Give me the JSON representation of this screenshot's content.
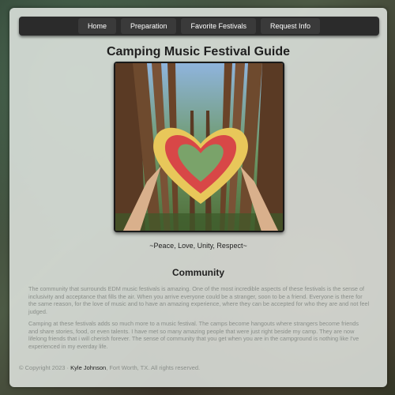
{
  "nav": {
    "items": [
      {
        "label": "Home"
      },
      {
        "label": "Preparation"
      },
      {
        "label": "Favorite Festivals"
      },
      {
        "label": "Request Info"
      }
    ]
  },
  "page": {
    "title": "Camping Music Festival Guide",
    "caption": "~Peace, Love, Unity, Respect~"
  },
  "community": {
    "heading": "Community",
    "paragraphs": [
      "The community that surrounds EDM music festivals is amazing. One of the most incredible aspects of these festivals is the sense of inclusivity and acceptance that fills the air. When you arrive everyone could be a stranger, soon to be a friend. Everyone is there for the same reason, for the love of music and to have an amazing experience, where they can be accepted for who they are and not feel judged.",
      "Camping at these festivals adds so much more to a music festival. The camps become hangouts where strangers become friends and share stories, food, or even talents. I have met so many amazing people that were just right beside my camp. They are now lifelong friends that i will cherish forever. The sense of community that you get when you are in the campground is nothing like I've experienced in my everday life."
    ]
  },
  "footer": {
    "copyright": "© Copyright 2023 · ",
    "name": "Kyle Johnson",
    "rest": ", Fort Worth, TX. All rights reserved."
  }
}
